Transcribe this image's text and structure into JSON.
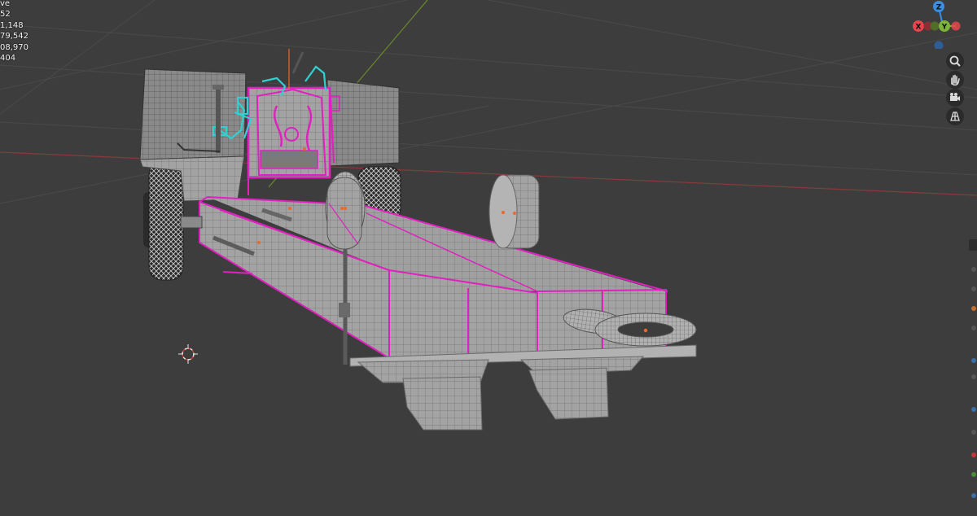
{
  "viewport": {
    "stats_lines": [
      "ve",
      "52",
      "1,148",
      "79,542",
      "08,970",
      "404"
    ]
  },
  "gizmo": {
    "z_label": "Z",
    "x_label": "X",
    "y_label": "Y",
    "colors": {
      "x": "#e8454e",
      "y": "#7db33a",
      "z": "#3b8de0"
    }
  },
  "nav_tools": [
    {
      "name": "zoom-icon",
      "glyph": "⌕"
    },
    {
      "name": "hand-icon",
      "glyph": "✋"
    },
    {
      "name": "camera-icon",
      "glyph": "🎥"
    },
    {
      "name": "grid-icon",
      "glyph": "▦"
    }
  ],
  "colors": {
    "background": "#3d3d3d",
    "mesh": "#a0a0a0",
    "wire": "#3a3a3a",
    "selection": "#e020c0",
    "active_child": "#30d0d0",
    "origin": "#e86a2c",
    "grid_red_axis": "#8a3a3a",
    "grid_green_axis": "#6a8a2a"
  }
}
